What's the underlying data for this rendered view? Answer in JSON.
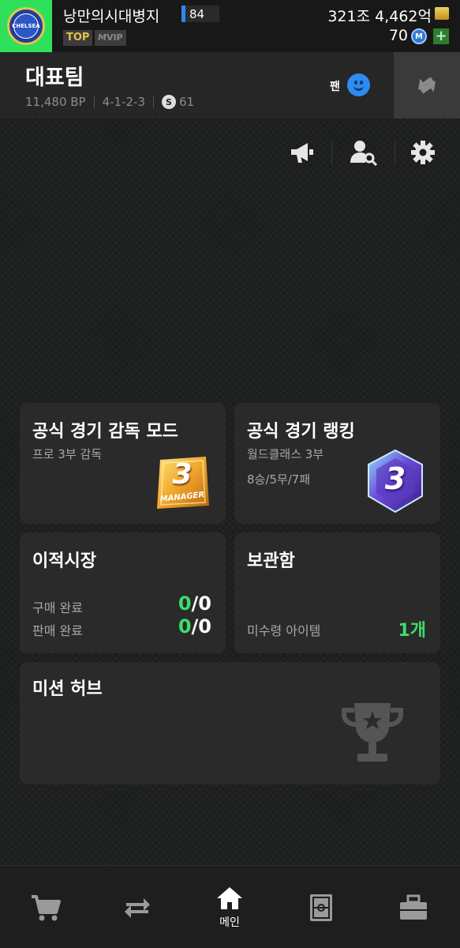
{
  "header": {
    "team_name": "낭만의시대병지",
    "ovr": "84",
    "badge_top": "TOP",
    "badge_vip": "VIP",
    "badge_vip_prefix": "M",
    "coins": "321조 4,462억",
    "mcoin": "70",
    "mcoin_symbol": "M",
    "crest_text": "CHELSEA"
  },
  "squad": {
    "title": "대표팀",
    "bp": "11,480 BP",
    "formation": "4-1-2-3",
    "s_symbol": "S",
    "s_value": "61",
    "fan_label": "팬"
  },
  "toolbar": {
    "icons": [
      "megaphone-icon",
      "user-search-icon",
      "gear-icon"
    ]
  },
  "cards": {
    "manager_mode": {
      "title": "공식 경기 감독 모드",
      "subtitle": "프로 3부 감독",
      "badge_number": "3",
      "badge_text": "MANAGER"
    },
    "ranking": {
      "title": "공식 경기 랭킹",
      "subtitle": "월드클래스 3부",
      "record": "8승/5무/7패",
      "badge_number": "3"
    },
    "transfer": {
      "title": "이적시장",
      "buy_label": "구매 완료",
      "buy_done": "0",
      "buy_total": "/0",
      "sell_label": "판매 완료",
      "sell_done": "0",
      "sell_total": "/0"
    },
    "storage": {
      "title": "보관함",
      "unclaimed_label": "미수령 아이템",
      "unclaimed_value": "1개"
    },
    "mission": {
      "title": "미션 허브"
    }
  },
  "nav": {
    "items": [
      {
        "icon": "cart-icon",
        "label": ""
      },
      {
        "icon": "transfer-arrows-icon",
        "label": ""
      },
      {
        "icon": "home-icon",
        "label": "메인"
      },
      {
        "icon": "pitch-icon",
        "label": ""
      },
      {
        "icon": "briefcase-icon",
        "label": ""
      }
    ]
  },
  "colors": {
    "accent_green": "#3ddc6a",
    "crest_bg": "#2fe05a",
    "fan_blue": "#2d8cf0"
  }
}
